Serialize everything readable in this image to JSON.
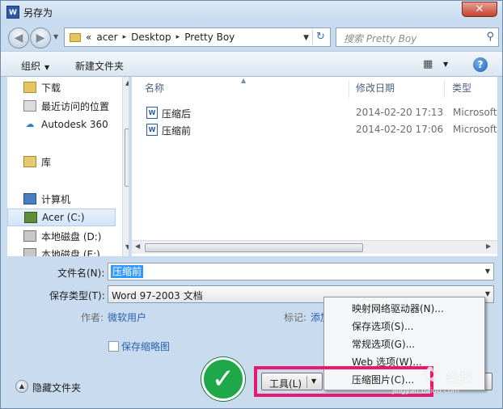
{
  "window": {
    "title": "另存为",
    "app_icon_label": "W",
    "close_label": "✕"
  },
  "nav": {
    "back_label": "◀",
    "forward_label": "▶",
    "breadcrumb_prefix": "«",
    "breadcrumb": [
      "acer",
      "Desktop",
      "Pretty Boy"
    ],
    "breadcrumb_sep": "▸",
    "refresh_label": "↻",
    "search_placeholder": "搜索 Pretty Boy"
  },
  "toolbar": {
    "organize_label": "组织",
    "new_folder_label": "新建文件夹",
    "help_label": "?"
  },
  "sidebar": {
    "items": [
      {
        "label": "下载",
        "icon": "download-folder-icon"
      },
      {
        "label": "最近访问的位置",
        "icon": "recent-places-icon"
      },
      {
        "label": "Autodesk 360",
        "icon": "autodesk-icon"
      },
      {
        "label": "库",
        "icon": "library-icon"
      },
      {
        "label": "计算机",
        "icon": "computer-icon"
      },
      {
        "label": "Acer (C:)",
        "icon": "drive-icon"
      },
      {
        "label": "本地磁盘 (D:)",
        "icon": "disk-icon"
      },
      {
        "label": "本地磁盘 (E:)",
        "icon": "disk-icon"
      }
    ]
  },
  "files": {
    "columns": [
      "名称",
      "修改日期",
      "类型"
    ],
    "rows": [
      {
        "name": "压缩后",
        "date": "2014-02-20 17:13",
        "type": "Microsoft"
      },
      {
        "name": "压缩前",
        "date": "2014-02-20 17:06",
        "type": "Microsoft"
      }
    ]
  },
  "form": {
    "filename_label": "文件名(N):",
    "filename_value": "压缩前",
    "filetype_label": "保存类型(T):",
    "filetype_value": "Word 97-2003 文档",
    "author_label": "作者:",
    "author_value": "微软用户",
    "tags_label": "标记:",
    "tags_value": "添加",
    "thumbnail_label": "保存缩略图",
    "hide_folders_label": "隐藏文件夹"
  },
  "buttons": {
    "tools_label": "工具(L)"
  },
  "tools_menu": {
    "items": [
      "映射网络驱动器(N)...",
      "保存选项(S)...",
      "常规选项(G)...",
      "Web 选项(W)...",
      "压缩图片(C)..."
    ]
  },
  "watermark": {
    "brand_cn": "经验",
    "brand_url": "jingyan.baidu.com"
  },
  "colors": {
    "highlight": "#e8186e",
    "check_badge": "#1fa84a",
    "selection": "#3399ff"
  }
}
